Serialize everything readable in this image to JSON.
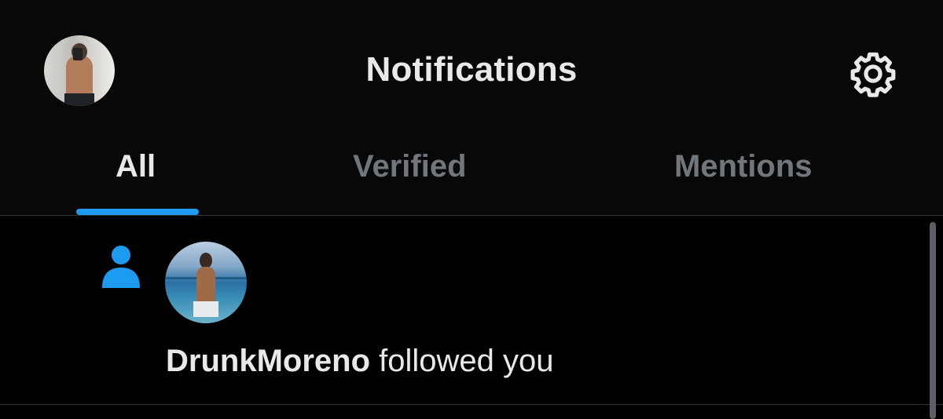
{
  "header": {
    "title": "Notifications",
    "avatar_icon": "profile-avatar",
    "settings_icon": "gear-icon"
  },
  "tabs": [
    {
      "label": "All",
      "active": true
    },
    {
      "label": "Verified",
      "active": false
    },
    {
      "label": "Mentions",
      "active": false
    }
  ],
  "notifications": [
    {
      "type_icon": "person-icon",
      "username": "DrunkMoreno",
      "action": "followed you"
    }
  ],
  "colors": {
    "accent": "#1d9bf0",
    "background": "#000000",
    "text_primary": "#e7e9ea",
    "text_secondary": "#71767b",
    "divider": "#2f3336"
  }
}
